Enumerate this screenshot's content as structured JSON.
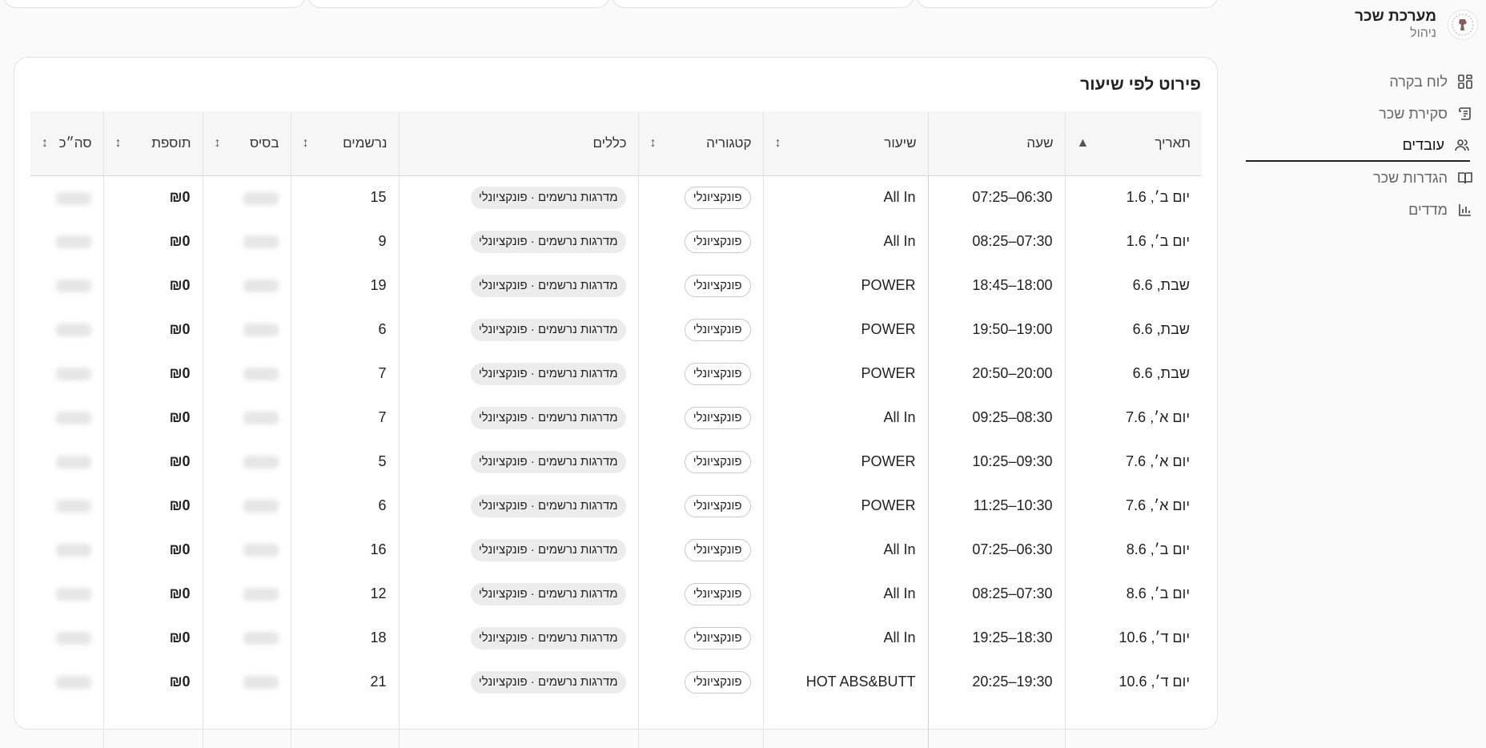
{
  "brand": {
    "title": "מערכת שכר",
    "subtitle": "ניהול"
  },
  "nav": [
    {
      "label": "לוח בקרה",
      "icon": "dashboard-icon",
      "active": false
    },
    {
      "label": "סקירת שכר",
      "icon": "receipt-icon",
      "active": false
    },
    {
      "label": "עובדים",
      "icon": "users-icon",
      "active": true
    },
    {
      "label": "הגדרות שכר",
      "icon": "book-icon",
      "active": false
    },
    {
      "label": "מדדים",
      "icon": "bar-chart-icon",
      "active": false
    }
  ],
  "section": {
    "title": "פירוט לפי שיעור"
  },
  "table": {
    "headers": {
      "date": "תאריך",
      "hour": "שעה",
      "class": "שיעור",
      "category": "קטגוריה",
      "rules": "כללים",
      "registered": "נרשמים",
      "base": "בסיס",
      "extra": "תוספת",
      "total": "סה״כ"
    },
    "sort_active": "▲",
    "sort_neutral": "↕",
    "rows": [
      {
        "date": "יום ב׳, 1.6",
        "hour": "06:30–07:25",
        "class": "All In",
        "category": "פונקציונלי",
        "rules": "מדרגות נרשמים · פונקציונלי",
        "registered": "15",
        "extra": "₪0"
      },
      {
        "date": "יום ב׳, 1.6",
        "hour": "07:30–08:25",
        "class": "All In",
        "category": "פונקציונלי",
        "rules": "מדרגות נרשמים · פונקציונלי",
        "registered": "9",
        "extra": "₪0"
      },
      {
        "date": "שבת, 6.6",
        "hour": "18:00–18:45",
        "class": "POWER",
        "category": "פונקציונלי",
        "rules": "מדרגות נרשמים · פונקציונלי",
        "registered": "19",
        "extra": "₪0"
      },
      {
        "date": "שבת, 6.6",
        "hour": "19:00–19:50",
        "class": "POWER",
        "category": "פונקציונלי",
        "rules": "מדרגות נרשמים · פונקציונלי",
        "registered": "6",
        "extra": "₪0"
      },
      {
        "date": "שבת, 6.6",
        "hour": "20:00–20:50",
        "class": "POWER",
        "category": "פונקציונלי",
        "rules": "מדרגות נרשמים · פונקציונלי",
        "registered": "7",
        "extra": "₪0"
      },
      {
        "date": "יום א׳, 7.6",
        "hour": "08:30–09:25",
        "class": "All In",
        "category": "פונקציונלי",
        "rules": "מדרגות נרשמים · פונקציונלי",
        "registered": "7",
        "extra": "₪0"
      },
      {
        "date": "יום א׳, 7.6",
        "hour": "09:30–10:25",
        "class": "POWER",
        "category": "פונקציונלי",
        "rules": "מדרגות נרשמים · פונקציונלי",
        "registered": "5",
        "extra": "₪0"
      },
      {
        "date": "יום א׳, 7.6",
        "hour": "10:30–11:25",
        "class": "POWER",
        "category": "פונקציונלי",
        "rules": "מדרגות נרשמים · פונקציונלי",
        "registered": "6",
        "extra": "₪0"
      },
      {
        "date": "יום ב׳, 8.6",
        "hour": "06:30–07:25",
        "class": "All In",
        "category": "פונקציונלי",
        "rules": "מדרגות נרשמים · פונקציונלי",
        "registered": "16",
        "extra": "₪0"
      },
      {
        "date": "יום ב׳, 8.6",
        "hour": "07:30–08:25",
        "class": "All In",
        "category": "פונקציונלי",
        "rules": "מדרגות נרשמים · פונקציונלי",
        "registered": "12",
        "extra": "₪0"
      },
      {
        "date": "יום ד׳, 10.6",
        "hour": "18:30–19:25",
        "class": "All In",
        "category": "פונקציונלי",
        "rules": "מדרגות נרשמים · פונקציונלי",
        "registered": "18",
        "extra": "₪0"
      },
      {
        "date": "יום ד׳, 10.6",
        "hour": "19:30–20:25",
        "class": "HOT ABS&BUTT",
        "category": "פונקציונלי",
        "rules": "מדרגות נרשמים · פונקציונלי",
        "registered": "21",
        "extra": "₪0"
      },
      {
        "date": "",
        "hour": "",
        "class": "",
        "category": "",
        "rules": "",
        "registered": "",
        "extra": ""
      }
    ]
  }
}
